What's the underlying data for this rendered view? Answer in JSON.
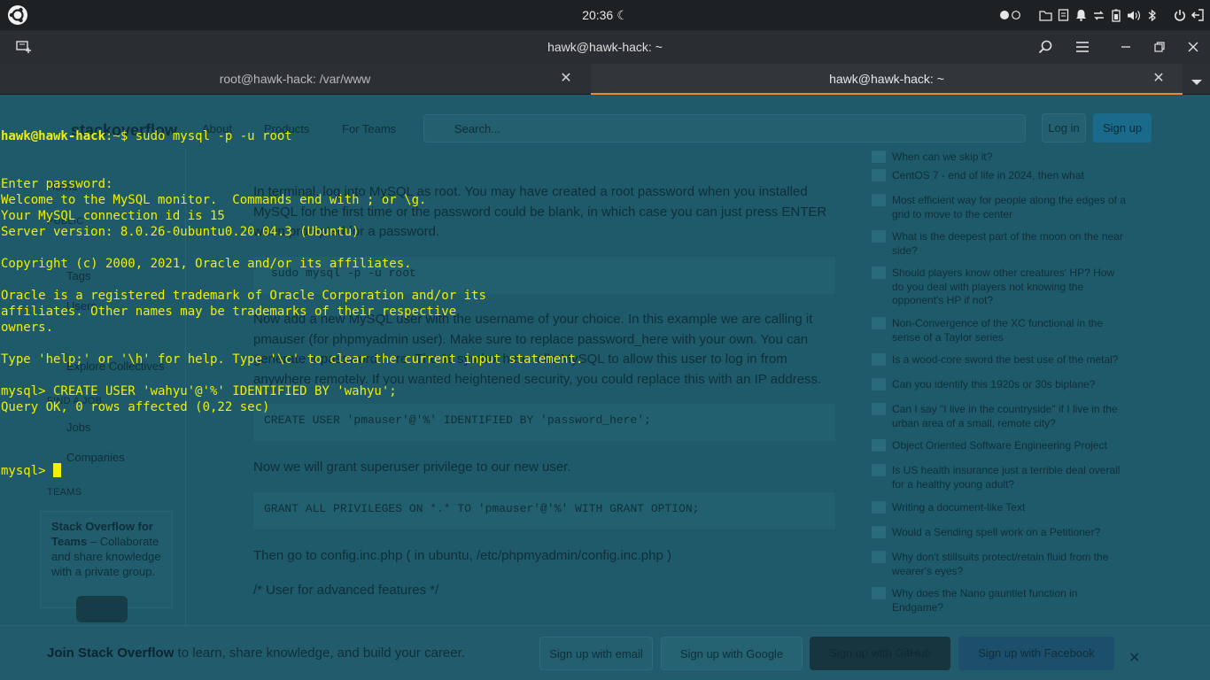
{
  "system_panel": {
    "time": "20:36",
    "icons": [
      "distro-logo-icon",
      "moon-icon",
      "toggle-icon",
      "folder-icon",
      "notes-icon",
      "bell-icon",
      "network-icon",
      "battery-icon",
      "volume-icon",
      "bluetooth-icon",
      "power-icon",
      "logout-icon"
    ]
  },
  "window": {
    "title": "hawk@hawk-hack: ~"
  },
  "tabs": [
    {
      "label": "root@hawk-hack: /var/www",
      "active": false
    },
    {
      "label": "hawk@hawk-hack: ~",
      "active": true
    }
  ],
  "terminal": {
    "prompt_user": "hawk@hawk-hack",
    "prompt_rest": ":~$ sudo mysql -p -u root",
    "lines": [
      "Enter password:",
      "Welcome to the MySQL monitor.  Commands end with ; or \\g.",
      "Your MySQL connection id is 15",
      "Server version: 8.0.26-0ubuntu0.20.04.3 (Ubuntu)",
      "",
      "Copyright (c) 2000, 2021, Oracle and/or its affiliates.",
      "",
      "Oracle is a registered trademark of Oracle Corporation and/or its",
      "affiliates. Other names may be trademarks of their respective",
      "owners.",
      "",
      "Type 'help;' or '\\h' for help. Type '\\c' to clear the current input statement.",
      "",
      "mysql> CREATE USER 'wahyu'@'%' IDENTIFIED BY 'wahyu';",
      "Query OK, 0 rows affected (0,22 sec)",
      ""
    ],
    "last_prompt": "mysql> "
  },
  "background_page": {
    "logo": "stackoverflow",
    "nav": [
      "About",
      "Products",
      "For Teams"
    ],
    "search_placeholder": "Search...",
    "login": "Log in",
    "signup": "Sign up",
    "left_nav": {
      "home": "Home",
      "public": "PUBLIC",
      "questions": "Questions",
      "tags": "Tags",
      "users": "Users",
      "companies_item": "Companies",
      "collectives": "Explore Collectives",
      "find_a_job": "FIND A JOB",
      "jobs": "Jobs",
      "companies": "Companies",
      "teams": "TEAMS",
      "teams_box_bold": "Stack Overflow for Teams",
      "teams_box_text": " – Collaborate and share knowledge with a private group."
    },
    "main": {
      "p1": "In terminal, log into MySQL as root. You may have created a root password when you installed MySQL for the first time or the password could be blank, in which case you can just press ENTER when prompted for a password.",
      "code1": "sudo mysql -p -u root",
      "p2": "Now add a new MySQL user with the username of your choice. In this example we are calling it pmauser (for phpmyadmin user). Make sure to replace password_here with your own. You can generate a password here. The % symbol here tells MySQL to allow this user to log in from anywhere remotely. If you wanted heightened security, you could replace this with an IP address.",
      "code2": "CREATE USER 'pmauser'@'%' IDENTIFIED BY 'password_here';",
      "p3": "Now we will grant superuser privilege to our new user.",
      "code3": "GRANT ALL PRIVILEGES ON *.* TO 'pmauser'@'%' WITH GRANT OPTION;",
      "p4": "Then go to config.inc.php ( in ubuntu, /etc/phpmyadmin/config.inc.php )",
      "p5": "/* User for advanced features */"
    },
    "hot_questions": [
      "When can we skip it?",
      "CentOS 7 - end of life in 2024, then what",
      "Most efficient way for people along the edges of a grid to move to the center",
      "What is the deepest part of the moon on the near side?",
      "Should players know other creatures' HP? How do you deal with players not knowing the opponent's HP if not?",
      "Non-Convergence of the XC functional in the sense of a Taylor series",
      "Is a wood-core sword the best use of the metal?",
      "Can you identify this 1920s or 30s biplane?",
      "Can I say \"I live in the countryside\" if I live in the urban area of a small, remote city?",
      "Object Oriented Software Engineering Project",
      "Is US health insurance just a terrible deal overall for a healthy young adult?",
      "Writing a document-like Text",
      "Would a Sending spell work on a Petitioner?",
      "Why don't stillsuits protect/retain fluid from the wearer's eyes?",
      "Why does the Nano gauntlet function in Endgame?"
    ],
    "footer": {
      "join_bold": "Join Stack Overflow",
      "join_rest": " to learn, share knowledge, and build your career.",
      "email": "Sign up with email",
      "google": "Sign up with Google",
      "github": "Sign up with GitHub",
      "facebook": "Sign up with Facebook"
    }
  }
}
